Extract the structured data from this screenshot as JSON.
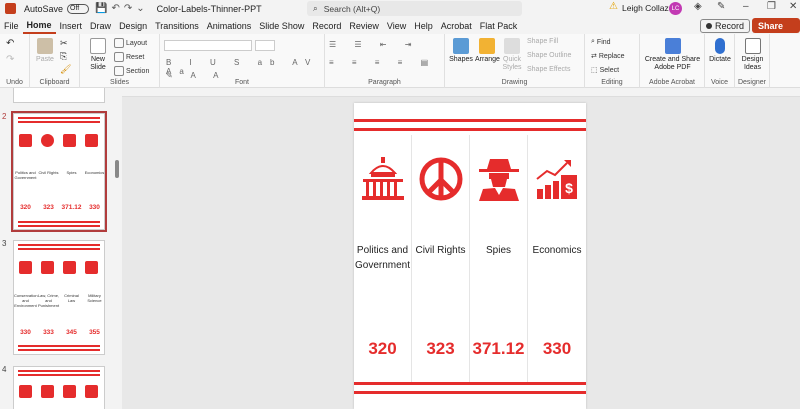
{
  "titlebar": {
    "autosave": "AutoSave",
    "toggle": "Off",
    "docname": "Color-Labels-Thinner-PPT",
    "search_placeholder": "Search (Alt+Q)",
    "user": "Leigh Collazo",
    "initials": "LC"
  },
  "menu": {
    "tabs": [
      "File",
      "Home",
      "Insert",
      "Draw",
      "Design",
      "Transitions",
      "Animations",
      "Slide Show",
      "Record",
      "Review",
      "View",
      "Help",
      "Acrobat",
      "Flat Pack"
    ],
    "record": "Record",
    "share": "Share"
  },
  "ribbon": {
    "undo": "Undo",
    "clipboard": "Clipboard",
    "paste": "Paste",
    "new_slide": "New Slide",
    "layout": "Layout",
    "reset": "Reset",
    "section": "Section",
    "slides": "Slides",
    "font": "Font",
    "paragraph": "Paragraph",
    "shapes": "Shapes",
    "arrange": "Arrange",
    "quick_styles": "Quick Styles",
    "shape_fill": "Shape Fill",
    "shape_outline": "Shape Outline",
    "shape_effects": "Shape Effects",
    "drawing": "Drawing",
    "find": "Find",
    "replace": "Replace",
    "select": "Select",
    "editing": "Editing",
    "create_share": "Create and Share Adobe PDF",
    "adobe": "Adobe Acrobat",
    "dictate": "Dictate",
    "voice": "Voice",
    "design_ideas": "Design Ideas",
    "designer": "Designer"
  },
  "thumbs": {
    "slide2": {
      "num": "2",
      "labels": [
        "Politics and Government",
        "Civil Rights",
        "Spies",
        "Economics"
      ],
      "values": [
        "320",
        "323",
        "371.12",
        "330"
      ]
    },
    "slide3": {
      "num": "3",
      "labels": [
        "Conservation and Environment",
        "Law, Crime, and Punishment",
        "Criminal Law",
        "Military Science"
      ],
      "values": [
        "330",
        "333",
        "345",
        "355"
      ]
    },
    "slide4": {
      "num": "4"
    }
  },
  "slide": {
    "columns": [
      {
        "label": "Politics and Government",
        "value": "320",
        "icon": "capitol-icon"
      },
      {
        "label": "Civil Rights",
        "value": "323",
        "icon": "peace-icon"
      },
      {
        "label": "Spies",
        "value": "371.12",
        "icon": "spy-icon"
      },
      {
        "label": "Economics",
        "value": "330",
        "icon": "economics-chart-icon"
      }
    ],
    "accent": "#e52c2c"
  }
}
